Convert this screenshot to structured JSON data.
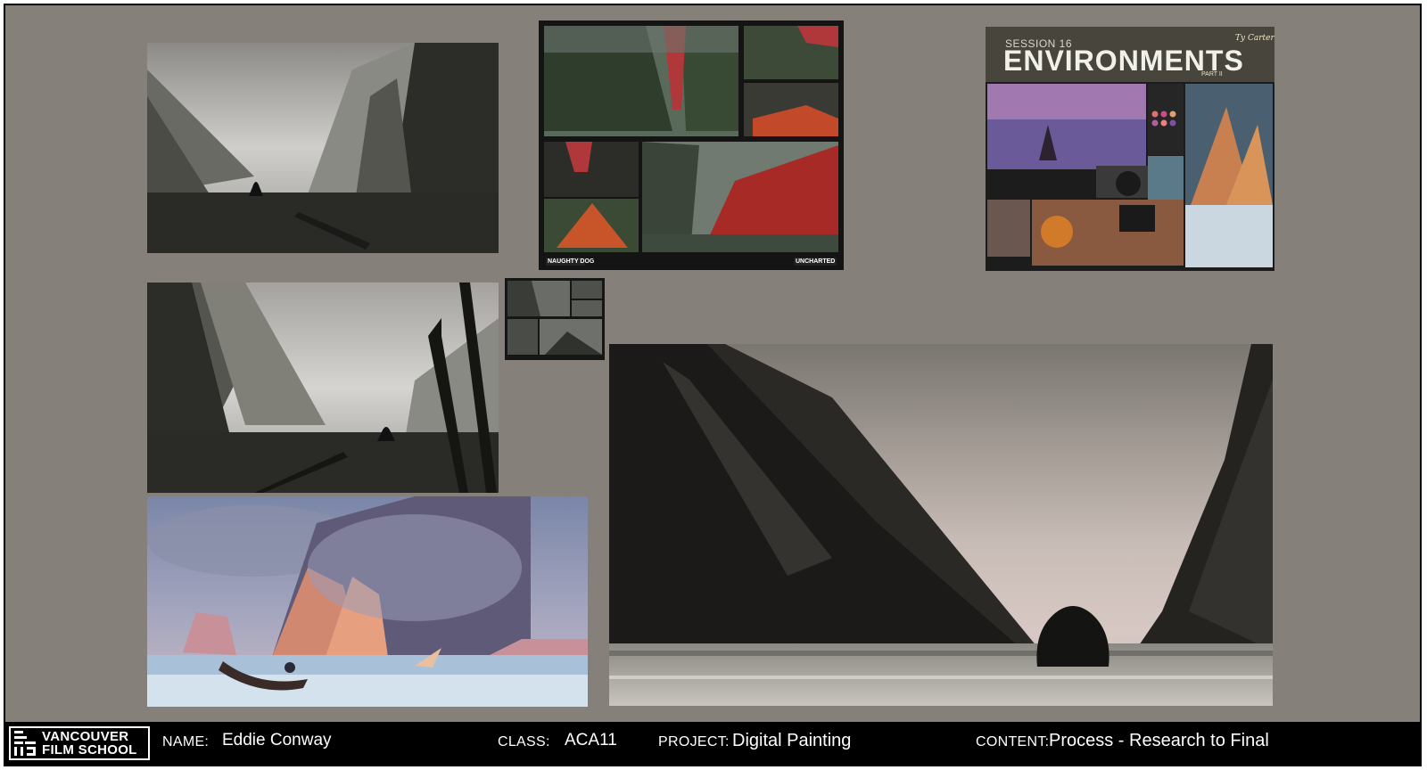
{
  "footer": {
    "school_line1": "VANCOUVER",
    "school_line2": "FILM SCHOOL",
    "name_label": "NAME:",
    "name_value": "Eddie Conway",
    "class_label": "CLASS:",
    "class_value": "ACA11",
    "project_label": "PROJECT:",
    "project_value": "Digital Painting",
    "content_label": "CONTENT:",
    "content_value": "Process - Research to Final"
  },
  "poster": {
    "session": "SESSION 16",
    "title": "ENVIRONMENTS",
    "part": "PART II",
    "author": "Ty Carter"
  },
  "reference_board": {
    "left_tag": "NAUGHTY DOG",
    "right_tag": "UNCHARTED"
  },
  "colors": {
    "board_background": "#85807a",
    "footer_background": "#000000",
    "accent_red": "#b0221e"
  }
}
